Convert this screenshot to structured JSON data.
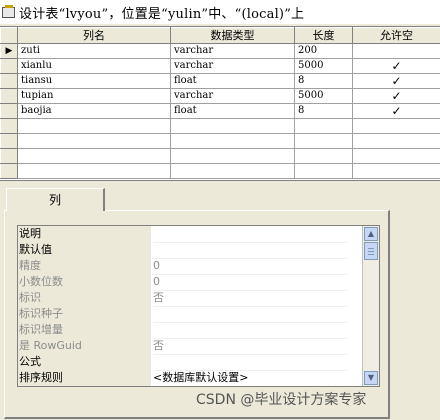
{
  "window": {
    "title": "设计表“lvyou”，位置是“yulin”中、“(local)”上",
    "icon": "table-design-icon"
  },
  "grid": {
    "headers": [
      "列名",
      "数据类型",
      "长度",
      "允许空"
    ],
    "rows": [
      {
        "name": "zuti",
        "type": "varchar",
        "length": "200",
        "nullable": ""
      },
      {
        "name": "xianlu",
        "type": "varchar",
        "length": "5000",
        "nullable": "✓"
      },
      {
        "name": "tiansu",
        "type": "float",
        "length": "8",
        "nullable": "✓"
      },
      {
        "name": "tupian",
        "type": "varchar",
        "length": "5000",
        "nullable": "✓"
      },
      {
        "name": "baojia",
        "type": "float",
        "length": "8",
        "nullable": "✓"
      }
    ],
    "current_row_indicator": "▶"
  },
  "tab": {
    "label": "列"
  },
  "properties": [
    {
      "label": "说明",
      "value": "",
      "disabled": false
    },
    {
      "label": "默认值",
      "value": "",
      "disabled": false
    },
    {
      "label": "精度",
      "value": "0",
      "disabled": true
    },
    {
      "label": "小数位数",
      "value": "0",
      "disabled": true
    },
    {
      "label": "标识",
      "value": "否",
      "disabled": true
    },
    {
      "label": "标识种子",
      "value": "",
      "disabled": true
    },
    {
      "label": "标识增量",
      "value": "",
      "disabled": true
    },
    {
      "label": "是 RowGuid",
      "value": "否",
      "disabled": true
    },
    {
      "label": "公式",
      "value": "",
      "disabled": false
    },
    {
      "label": "排序规则",
      "value": "<数据库默认设置>",
      "disabled": false
    }
  ],
  "watermark": "CSDN @毕业设计方案专家"
}
